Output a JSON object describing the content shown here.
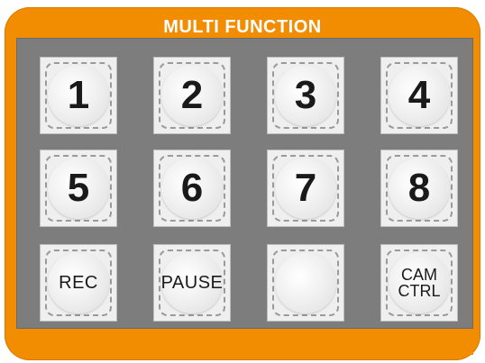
{
  "panel": {
    "title": "MULTI FUNCTION"
  },
  "keys": {
    "k1": "1",
    "k2": "2",
    "k3": "3",
    "k4": "4",
    "k5": "5",
    "k6": "6",
    "k7": "7",
    "k8": "8",
    "rec": "REC",
    "pause": "PAUSE",
    "blank": "",
    "camctrl": "CAM\nCTRL"
  },
  "colors": {
    "panel_orange": "#f28c00",
    "grid_gray": "#7d7d7d",
    "key_face": "#efefef"
  }
}
